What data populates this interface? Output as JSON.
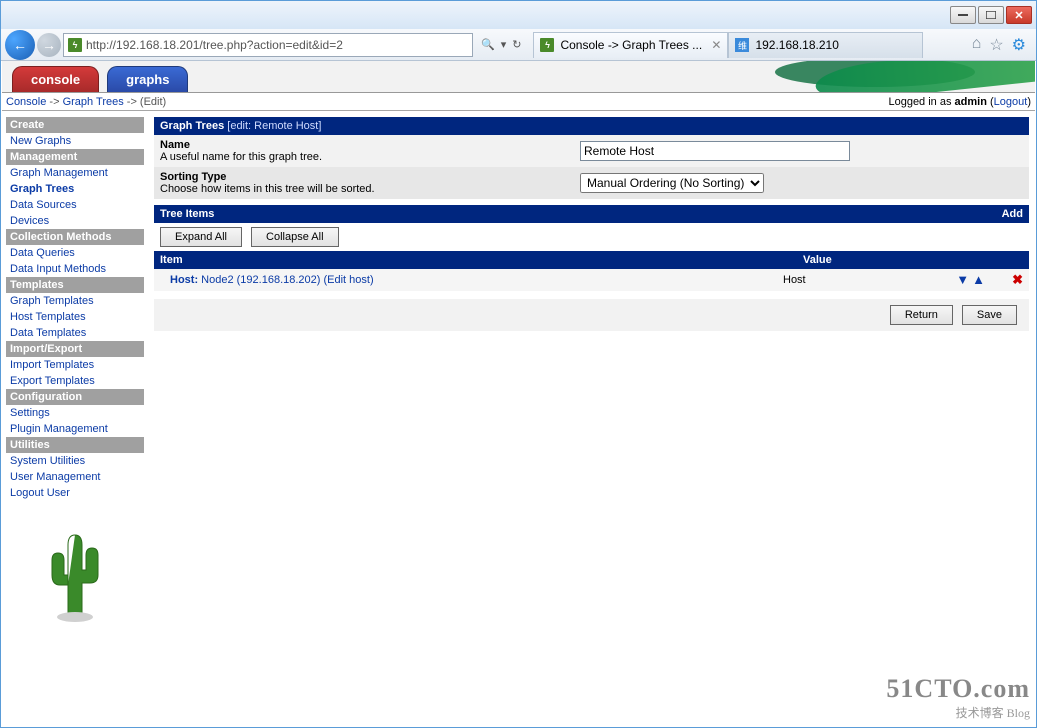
{
  "browser": {
    "url": "http://192.168.18.201/tree.php?action=edit&id=2",
    "tabs": [
      {
        "title": "Console -> Graph Trees ...",
        "active": true
      },
      {
        "title": "192.168.18.210",
        "active": false
      }
    ],
    "icons": {
      "home": "⌂",
      "star": "☆",
      "gear": "⚙"
    }
  },
  "app_tabs": {
    "console": "console",
    "graphs": "graphs"
  },
  "breadcrumb": {
    "c": "Console",
    "s1": "->",
    "g": "Graph Trees",
    "s2": "-> (Edit)"
  },
  "auth": {
    "prefix": "Logged in as ",
    "user": "admin",
    "logout": "Logout"
  },
  "sidebar": {
    "groups": [
      {
        "head": "Create",
        "items": [
          "New Graphs"
        ]
      },
      {
        "head": "Management",
        "items": [
          "Graph Management",
          "Graph Trees",
          "Data Sources",
          "Devices"
        ]
      },
      {
        "head": "Collection Methods",
        "items": [
          "Data Queries",
          "Data Input Methods"
        ]
      },
      {
        "head": "Templates",
        "items": [
          "Graph Templates",
          "Host Templates",
          "Data Templates"
        ]
      },
      {
        "head": "Import/Export",
        "items": [
          "Import Templates",
          "Export Templates"
        ]
      },
      {
        "head": "Configuration",
        "items": [
          "Settings",
          "Plugin Management"
        ]
      },
      {
        "head": "Utilities",
        "items": [
          "System Utilities",
          "User Management",
          "Logout User"
        ]
      }
    ],
    "active": "Graph Trees"
  },
  "panel": {
    "title": "Graph Trees",
    "sub": "[edit: Remote Host]",
    "fields": {
      "name_label": "Name",
      "name_desc": "A useful name for this graph tree.",
      "name_value": "Remote Host",
      "sort_label": "Sorting Type",
      "sort_desc": "Choose how items in this tree will be sorted.",
      "sort_value": "Manual Ordering (No Sorting)"
    }
  },
  "tree": {
    "title": "Tree Items",
    "add": "Add",
    "expand": "Expand All",
    "collapse": "Collapse All",
    "head_item": "Item",
    "head_value": "Value",
    "rows": [
      {
        "prefix": "Host:",
        "label": "Node2 (192.168.18.202)",
        "edit": "(Edit host)",
        "value": "Host"
      }
    ]
  },
  "buttons": {
    "return": "Return",
    "save": "Save"
  },
  "watermark": {
    "big": "51CTO.com",
    "sm": "技术博客 Blog"
  }
}
